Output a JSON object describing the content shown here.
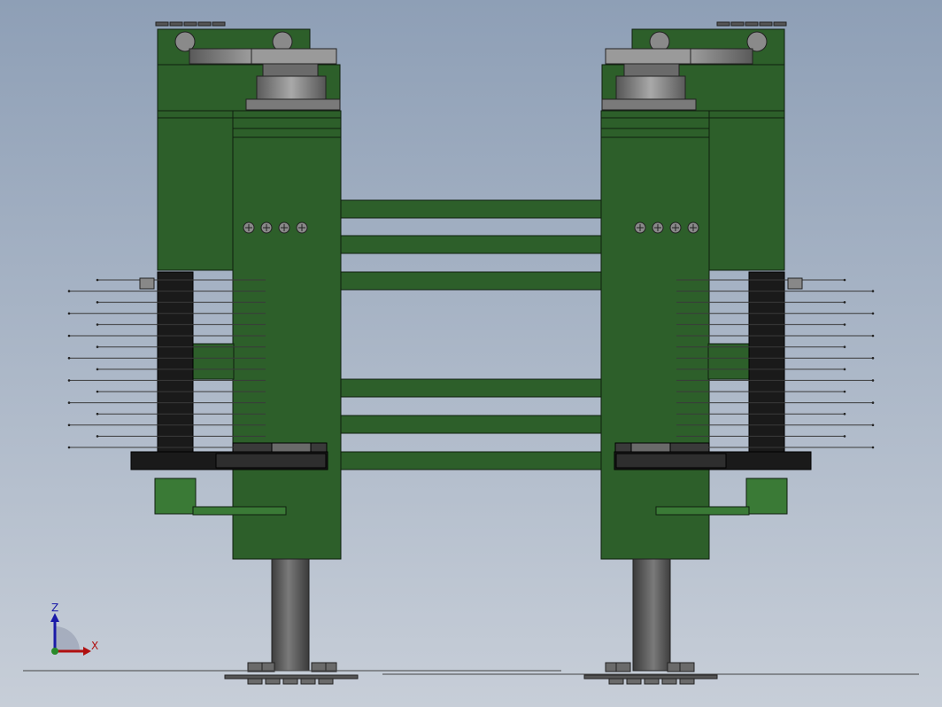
{
  "viewport": {
    "background_top": "#8e9fb6",
    "background_bottom": "#c7ced8"
  },
  "colors": {
    "body_green": "#2d5f2a",
    "light_green": "#3a7a36",
    "edge": "#0f1f0f",
    "black_part": "#1a1a1a",
    "steel": "#8a8a8a",
    "dark_steel": "#4a4a4a",
    "needle": "#3a3a3a"
  },
  "triad": {
    "z_label": "Z",
    "x_label": "X",
    "z_color": "#1a1aa8",
    "x_color": "#b01010",
    "icon": "coordinate-triad-icon"
  }
}
